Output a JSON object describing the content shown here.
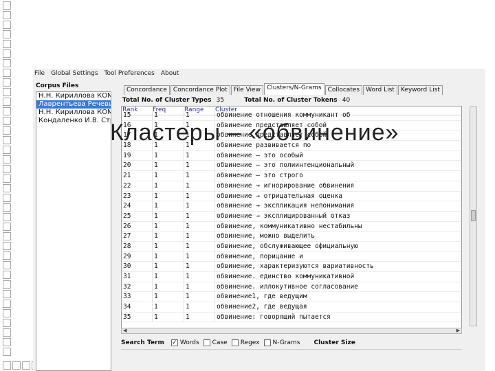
{
  "slide": {
    "title": "Кластеры – «обвинение»"
  },
  "menu": [
    "File",
    "Global Settings",
    "Tool Preferences",
    "About"
  ],
  "corpus": {
    "label": "Corpus Files",
    "files": [
      "Н.Н. Кириллова КОМ",
      "Лаврентьева Речевы",
      "Н.Н. Кириллова КОМ",
      "Кондаленко И.В. Стр"
    ],
    "selected_index": 1
  },
  "tabs": [
    "Concordance",
    "Concordance Plot",
    "File View",
    "Clusters/N-Grams",
    "Collocates",
    "Word List",
    "Keyword List"
  ],
  "active_tab": 3,
  "stats": {
    "types_label": "Total No. of Cluster Types",
    "types_value": "35",
    "tokens_label": "Total No. of Cluster Tokens",
    "tokens_value": "40"
  },
  "table": {
    "headers": {
      "rank": "Rank",
      "freq": "Freq",
      "range": "Range",
      "cluster": "Cluster"
    },
    "rows": [
      [
        "15",
        "1",
        "1",
        "обвинение отношения коммуникант об"
      ],
      [
        "16",
        "1",
        "1",
        "обвинение представляет собой"
      ],
      [
        "17",
        "1",
        "1",
        "обвинение представляет собой"
      ],
      [
        "18",
        "1",
        "1",
        "обвинение развивается по"
      ],
      [
        "19",
        "1",
        "1",
        "обвинение – это особый"
      ],
      [
        "20",
        "1",
        "1",
        "обвинение – это полиинтенциональный"
      ],
      [
        "21",
        "1",
        "1",
        "обвинение – это строго"
      ],
      [
        "22",
        "1",
        "1",
        "обвинение → игнорирование обвинения"
      ],
      [
        "23",
        "1",
        "1",
        "обвинение → отрицательная оценка"
      ],
      [
        "24",
        "1",
        "1",
        "обвинение → экспликация непонимания"
      ],
      [
        "25",
        "1",
        "1",
        "обвинение → эксплицированный отказ"
      ],
      [
        "26",
        "1",
        "1",
        "обвинение, коммуникативно нестабильны"
      ],
      [
        "27",
        "1",
        "1",
        "обвинение, можно выделить"
      ],
      [
        "28",
        "1",
        "1",
        "обвинение, обслуживающее официальную"
      ],
      [
        "29",
        "1",
        "1",
        "обвинение, порицание и"
      ],
      [
        "30",
        "1",
        "1",
        "обвинение, характеризуются вариативность"
      ],
      [
        "31",
        "1",
        "1",
        "обвинение. единство коммуникативной"
      ],
      [
        "32",
        "1",
        "1",
        "обвинение. иллокутивное согласование"
      ],
      [
        "33",
        "1",
        "1",
        "обвинение1, где ведущим"
      ],
      [
        "34",
        "1",
        "1",
        "обвинение2, где ведущая"
      ],
      [
        "35",
        "1",
        "1",
        "обвинение: говорящий пытается"
      ]
    ]
  },
  "search": {
    "label": "Search Term",
    "options": [
      {
        "name": "Words",
        "checked": true
      },
      {
        "name": "Case",
        "checked": false
      },
      {
        "name": "Regex",
        "checked": false
      },
      {
        "name": "N-Grams",
        "checked": false
      }
    ],
    "cluster_size_label": "Cluster Size"
  }
}
